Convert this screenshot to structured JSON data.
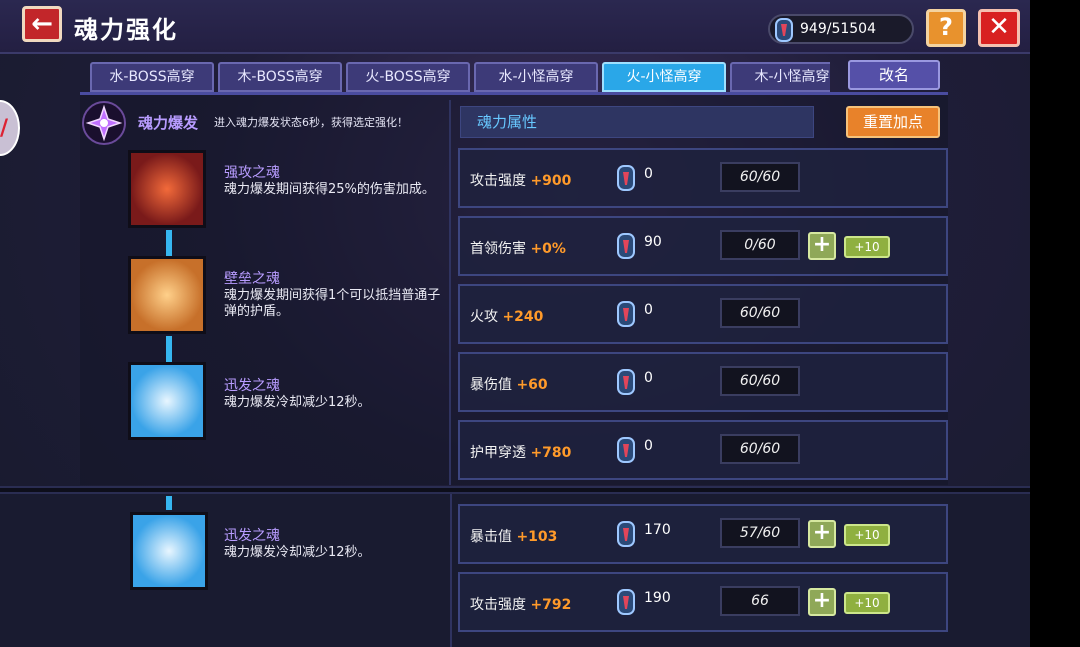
{
  "header": {
    "title": "魂力强化",
    "currency_value": "949/51504"
  },
  "tabs": [
    {
      "label": "水-BOSS高穿",
      "active": false
    },
    {
      "label": "木-BOSS高穿",
      "active": false
    },
    {
      "label": "火-BOSS高穿",
      "active": false
    },
    {
      "label": "水-小怪高穿",
      "active": false
    },
    {
      "label": "火-小怪高穿",
      "active": true
    },
    {
      "label": "木-小怪高穿",
      "active": false
    }
  ],
  "rename_label": "改名",
  "burst": {
    "label": "魂力爆发",
    "desc": "进入魂力爆发状态6秒，获得选定强化！"
  },
  "attr_header": "魂力属性",
  "reset_label": "重置加点",
  "souls": [
    {
      "name": "强攻之魂",
      "desc": "魂力爆发期间获得25%的伤害加成。"
    },
    {
      "name": "壁垒之魂",
      "desc": "魂力爆发期间获得1个可以抵挡普通子弹的护盾。"
    },
    {
      "name": "迅发之魂",
      "desc": "魂力爆发冷却减少12秒。"
    },
    {
      "name": "迅发之魂",
      "desc": "魂力爆发冷却减少12秒。"
    }
  ],
  "stats": [
    {
      "name": "攻击强度",
      "bonus": "+900",
      "cost": "0",
      "level": "60/60",
      "upgradable": false
    },
    {
      "name": "首领伤害",
      "bonus": "+0%",
      "cost": "90",
      "level": "0/60",
      "upgradable": true
    },
    {
      "name": "火攻",
      "bonus": "+240",
      "cost": "0",
      "level": "60/60",
      "upgradable": false
    },
    {
      "name": "暴伤值",
      "bonus": "+60",
      "cost": "0",
      "level": "60/60",
      "upgradable": false
    },
    {
      "name": "护甲穿透",
      "bonus": "+780",
      "cost": "0",
      "level": "60/60",
      "upgradable": false
    },
    {
      "name": "暴击值",
      "bonus": "+103",
      "cost": "170",
      "level": "57/60",
      "upgradable": true
    },
    {
      "name": "攻击强度",
      "bonus": "+792",
      "cost": "190",
      "level": "66",
      "upgradable": true
    }
  ],
  "plus10_label": "+10",
  "plus_label": "+",
  "colors": {
    "accent_blue": "#2aa7e8",
    "bonus_orange": "#ff9a2a",
    "soul_name_purple": "#b89cff",
    "close_red": "#d82020",
    "help_orange": "#e8922d"
  },
  "icons": {
    "back": "arrow-left-icon",
    "help": "question-icon",
    "close": "close-icon",
    "currency": "soul-gem-icon"
  }
}
